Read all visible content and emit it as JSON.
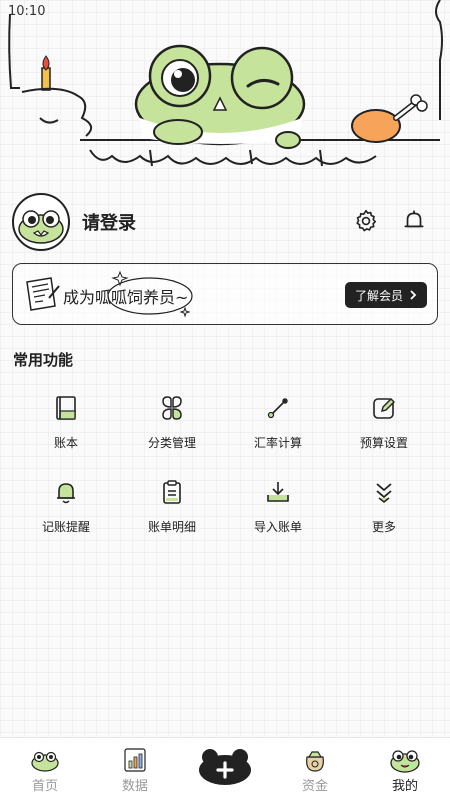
{
  "status": {
    "time": "10:10"
  },
  "profile": {
    "login_label": "请登录"
  },
  "member": {
    "text": "成为呱呱饲养员~",
    "button_label": "了解会员"
  },
  "section": {
    "title": "常用功能"
  },
  "features": [
    {
      "label": "账本",
      "icon": "ledger-book-icon"
    },
    {
      "label": "分类管理",
      "icon": "four-leaf-icon"
    },
    {
      "label": "汇率计算",
      "icon": "exchange-rate-icon"
    },
    {
      "label": "预算设置",
      "icon": "edit-square-icon"
    },
    {
      "label": "记账提醒",
      "icon": "bell-icon"
    },
    {
      "label": "账单明细",
      "icon": "clipboard-icon"
    },
    {
      "label": "导入账单",
      "icon": "download-tray-icon"
    },
    {
      "label": "更多",
      "icon": "double-chevron-down-icon"
    }
  ],
  "tabs": [
    {
      "label": "首页",
      "active": false
    },
    {
      "label": "数据",
      "active": false
    },
    {
      "label": "",
      "icon": "add-icon"
    },
    {
      "label": "资金",
      "active": false
    },
    {
      "label": "我的",
      "active": true
    }
  ],
  "colors": {
    "frog_green": "#c5e39a",
    "chicken_orange": "#f7a45a",
    "dark": "#222222"
  }
}
